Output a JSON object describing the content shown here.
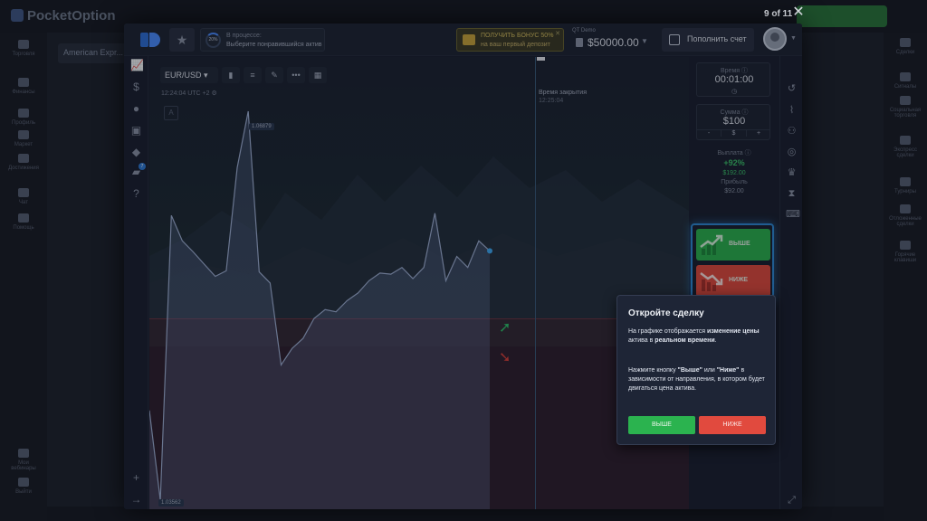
{
  "background": {
    "logo": "PocketOption",
    "asset": "American Expr...",
    "left_nav": [
      "Торговля",
      "Финансы",
      "Профиль",
      "Маркет",
      "Достижения",
      "Чат",
      "Помощь",
      "Мои вебинары",
      "Выйти"
    ],
    "right_nav": [
      "Сделки",
      "Сигналы",
      "Социальная торговля",
      "Экспресс сделки",
      "Турниры",
      "Отложенные сделки",
      "Горячие клавиши"
    ],
    "balance": "$50000",
    "topup_label": "ПОПОЛНИТЬ СЧЕТ"
  },
  "tour": {
    "counter": "9 of 11"
  },
  "header": {
    "star_icon": "star-icon",
    "progress_percent": "20%",
    "progress_status": "В процессе:",
    "progress_task": "Выберите понравившийся актив",
    "bonus_line1": "ПОЛУЧИТЬ БОНУС 50%",
    "bonus_line2": "на ваш первый депозит",
    "account_type": "QT Demo",
    "balance": "$50000.00",
    "topup_label": "Пополнить счет"
  },
  "chart": {
    "pair": "EUR/USD",
    "clock": "12:24:04 UTC +2",
    "indicator_badge": "A",
    "close_label": "Время закрытия",
    "close_time": "12:25:04",
    "high_label": "1.06879",
    "low_label": "1.03562"
  },
  "chart_data": {
    "type": "area",
    "title": "",
    "series": [
      {
        "values": [
          1.0447,
          1.0366,
          1.0623,
          1.06,
          1.059,
          1.0579,
          1.0568,
          1.0573,
          1.0666,
          1.0717,
          1.0572,
          1.0562,
          1.0488,
          1.0503,
          1.0512,
          1.053,
          1.0538,
          1.0536,
          1.0546,
          1.0553,
          1.0564,
          1.0571,
          1.057,
          1.0576,
          1.0566,
          1.0576,
          1.0625,
          1.0564,
          1.0586,
          1.0576,
          1.06,
          1.0591
        ]
      }
    ],
    "current_price_marker": 1.0591
  },
  "trade_panel": {
    "time_label": "Время",
    "time_value": "00:01:00",
    "amount_label": "Сумма",
    "amount_value": "$100",
    "amount_minus": "-",
    "amount_currency": "$",
    "amount_plus": "+",
    "payout_label": "Выплата",
    "payout_percent": "+92%",
    "payout_value": "$192.00",
    "profit_label": "Прибыль",
    "profit_value": "$92.00",
    "up_label": "ВЫШЕ",
    "down_label": "НИЖЕ",
    "colors": {
      "up": "#2bb34f",
      "down": "#e14a3e",
      "highlight": "#2f8ad8"
    }
  },
  "popup": {
    "title": "Откройте сделку",
    "p1_a": "На графике отображается ",
    "p1_b": "изменение цены",
    "p1_c": " актива в ",
    "p1_d": "реальном времени",
    "p1_e": ".",
    "p2_a": "Нажмите кнопку ",
    "p2_b": "\"Выше\"",
    "p2_c": " или ",
    "p2_d": "\"Ниже\"",
    "p2_e": " в зависимости от направления, в котором будет двигаться цена актива.",
    "up_button": "ВЫШЕ",
    "down_button": "НИЖЕ"
  }
}
